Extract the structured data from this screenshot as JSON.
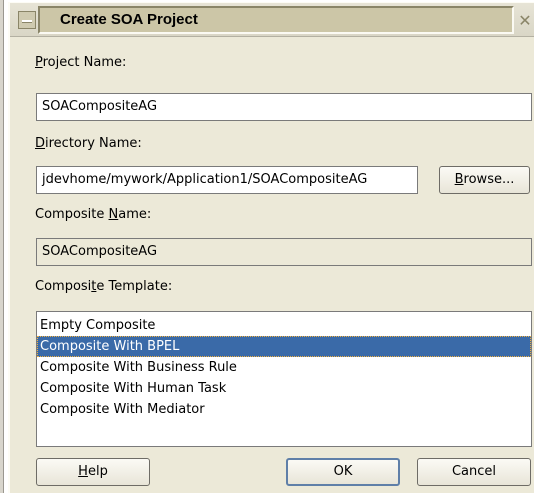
{
  "dialog": {
    "title": "Create SOA Project"
  },
  "project_name": {
    "label_mnemonic": "P",
    "label_rest": "roject Name:",
    "value": "SOACompositeAG"
  },
  "directory_name": {
    "label_mnemonic": "D",
    "label_rest": "irectory Name:",
    "value": "jdevhome/mywork/Application1/SOACompositeAG",
    "browse_mnemonic": "B",
    "browse_rest": "rowse..."
  },
  "composite_name": {
    "label_prefix": "Composite ",
    "label_mnemonic": "N",
    "label_rest": "ame:",
    "value": "SOACompositeAG"
  },
  "composite_template": {
    "label_prefix": "Composi",
    "label_mnemonic": "t",
    "label_rest": "e Template:",
    "items": [
      "Empty Composite",
      "Composite With BPEL",
      "Composite With Business Rule",
      "Composite With Human Task",
      "Composite With Mediator"
    ],
    "selected_index": 1
  },
  "buttons": {
    "help_mnemonic": "H",
    "help_rest": "elp",
    "ok": "OK",
    "cancel": "Cancel"
  },
  "icons": {
    "system_menu": "system-menu-icon",
    "close": "close-icon"
  },
  "colors": {
    "dialog_background": "#ece9d8",
    "title_background": "#ccc6a7",
    "selection": "#3a6aa8",
    "default_button_border": "#5f7fa8"
  }
}
